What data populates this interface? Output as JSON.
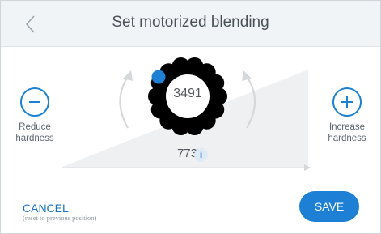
{
  "header": {
    "title": "Set motorized blending",
    "back_icon": "chevron-left-icon"
  },
  "controls": {
    "reduce": {
      "icon": "minus-icon",
      "label_line1": "Reduce",
      "label_line2": "hardness"
    },
    "increase": {
      "icon": "plus-icon",
      "label_line1": "Increase",
      "label_line2": "hardness"
    }
  },
  "dial": {
    "value": "3491",
    "level_value": "773",
    "info_icon": "info-icon",
    "info_glyph": "i"
  },
  "footer": {
    "cancel_label": "CANCEL",
    "cancel_note": "(reset to previous position)",
    "save_label": "SAVE"
  },
  "colors": {
    "accent": "#1e80d4",
    "header_bg": "#f1f4f6",
    "knob": "#000000",
    "ramp": "#eef0f2"
  }
}
